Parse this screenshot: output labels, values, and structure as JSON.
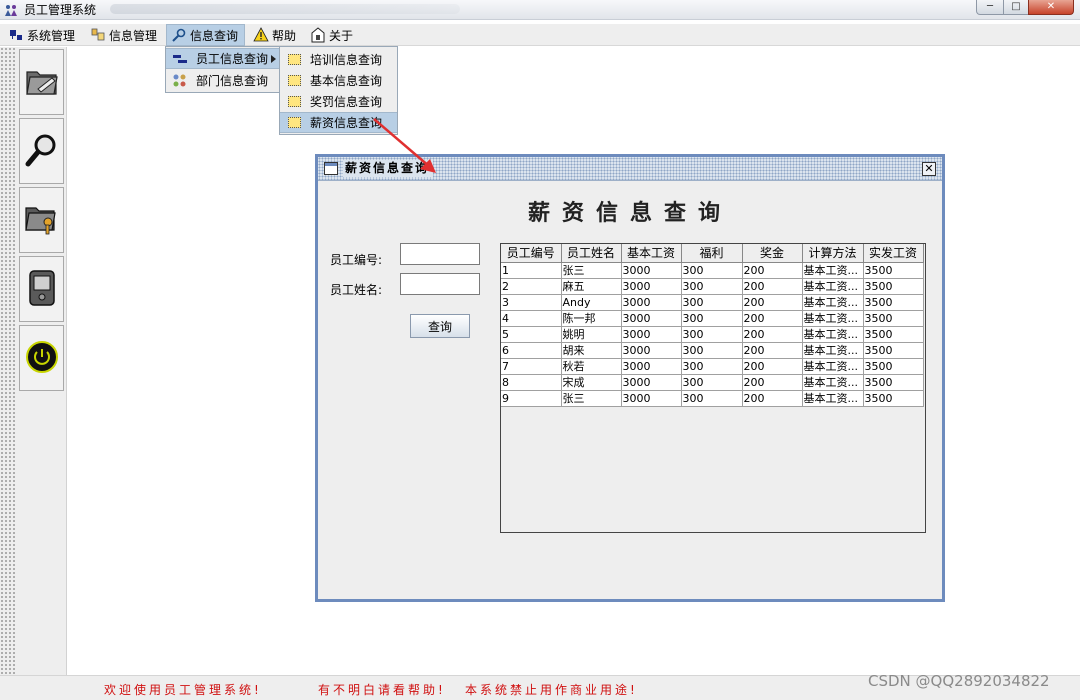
{
  "window": {
    "title": "员工管理系统",
    "controls": {
      "minimize": "─",
      "maximize": "□",
      "close": "✕"
    }
  },
  "menubar": {
    "items": [
      {
        "label": "系统管理",
        "icon": "system-manage-icon"
      },
      {
        "label": "信息管理",
        "icon": "info-manage-icon"
      },
      {
        "label": "信息查询",
        "icon": "search-icon"
      },
      {
        "label": "帮助",
        "icon": "warning-icon"
      },
      {
        "label": "关于",
        "icon": "about-icon"
      }
    ]
  },
  "dropdown_query": {
    "items": [
      {
        "label": "员工信息查询",
        "icon": "employee-icon",
        "has_submenu": true
      },
      {
        "label": "部门信息查询",
        "icon": "department-icon"
      }
    ]
  },
  "dropdown_sub": {
    "items": [
      {
        "label": "培训信息查询"
      },
      {
        "label": "基本信息查询"
      },
      {
        "label": "奖罚信息查询"
      },
      {
        "label": "薪资信息查询",
        "highlighted": true
      }
    ]
  },
  "toolbar": {
    "buttons": [
      {
        "name": "folder-edit-icon"
      },
      {
        "name": "magnifier-icon"
      },
      {
        "name": "folder-key-icon"
      },
      {
        "name": "pda-icon"
      },
      {
        "name": "power-icon"
      }
    ]
  },
  "internal_frame": {
    "title": "薪资信息查询",
    "heading": "薪资信息查询",
    "form": {
      "id_label": "员工编号:",
      "name_label": "员工姓名:",
      "id_value": "",
      "name_value": "",
      "query_button": "查询"
    },
    "table": {
      "columns": [
        "员工编号",
        "员工姓名",
        "基本工资",
        "福利",
        "奖金",
        "计算方法",
        "实发工资"
      ],
      "rows": [
        [
          "1",
          "张三",
          "3000",
          "300",
          "200",
          "基本工资...",
          "3500"
        ],
        [
          "2",
          "麻五",
          "3000",
          "300",
          "200",
          "基本工资...",
          "3500"
        ],
        [
          "3",
          "Andy",
          "3000",
          "300",
          "200",
          "基本工资...",
          "3500"
        ],
        [
          "4",
          "陈一邦",
          "3000",
          "300",
          "200",
          "基本工资...",
          "3500"
        ],
        [
          "5",
          "姚明",
          "3000",
          "300",
          "200",
          "基本工资...",
          "3500"
        ],
        [
          "6",
          "胡来",
          "3000",
          "300",
          "200",
          "基本工资...",
          "3500"
        ],
        [
          "7",
          "秋若",
          "3000",
          "300",
          "200",
          "基本工资...",
          "3500"
        ],
        [
          "8",
          "宋成",
          "3000",
          "300",
          "200",
          "基本工资...",
          "3500"
        ],
        [
          "9",
          "张三",
          "3000",
          "300",
          "200",
          "基本工资...",
          "3500"
        ]
      ]
    }
  },
  "statusbar": {
    "messages": [
      "欢迎使用员工管理系统!",
      "有不明白请看帮助!",
      "本系统禁止用作商业用途!"
    ]
  },
  "watermark": "CSDN @QQ2892034822",
  "colors": {
    "frame_border": "#6d8bbd",
    "menu_highlight": "#b8cfe5",
    "status_text": "#d01010",
    "arrow": "#e03030"
  }
}
